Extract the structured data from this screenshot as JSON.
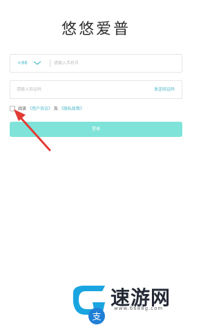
{
  "app": {
    "title": "悠悠爱普"
  },
  "phone": {
    "country_code": "+86",
    "placeholder": "请输入手机号"
  },
  "code": {
    "placeholder": "请输入验证码",
    "send_label": "发送验证码"
  },
  "agreement": {
    "prefix": "阅读",
    "user_agreement": "《用户协议》",
    "conjunction": "及",
    "privacy_policy": "《隐私政策》",
    "checked": false
  },
  "login": {
    "label": "登录"
  },
  "watermark": {
    "brand": "速游网",
    "url": "www.6688g.com"
  },
  "colors": {
    "accent": "#4fb9c9",
    "button": "#7fe3d9",
    "arrow": "#e33a34"
  }
}
